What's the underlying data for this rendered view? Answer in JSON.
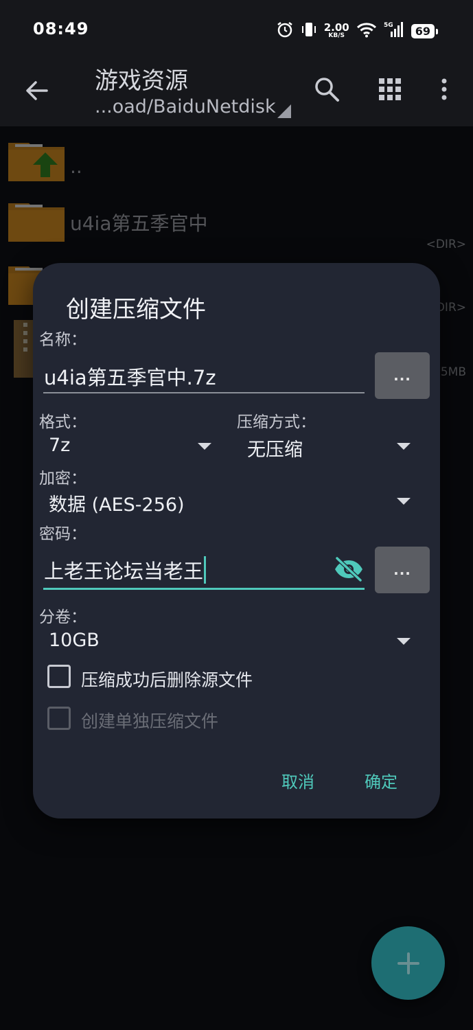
{
  "status_bar": {
    "time": "08:49",
    "net_speed_value": "2.00",
    "net_speed_unit": "KB/S",
    "signal_label": "5G",
    "battery": "69",
    "icons": [
      "alarm-icon",
      "vibrate-icon",
      "wifi-icon",
      "signal-icon",
      "battery-icon"
    ]
  },
  "app_bar": {
    "title": "游戏资源",
    "path": "...oad/BaiduNetdisk",
    "icons": [
      "back-arrow-icon",
      "search-icon",
      "grid-view-icon",
      "more-vert-icon"
    ]
  },
  "file_list": [
    {
      "name": "..",
      "meta": ""
    },
    {
      "name": "u4ia第五季官中",
      "meta": "<DIR>"
    },
    {
      "name": "",
      "meta": "<DIR>"
    },
    {
      "name": "",
      "meta": "5MB"
    }
  ],
  "dialog": {
    "title": "创建压缩文件",
    "name_label": "名称：",
    "name_value": "u4ia第五季官中.7z",
    "browse_label": "...",
    "format_label": "格式：",
    "format_value": "7z",
    "compression_label": "压缩方式：",
    "compression_value": "无压缩",
    "encryption_label": "加密：",
    "encryption_value": "数据 (AES-256)",
    "password_label": "密码：",
    "password_value": "上老王论坛当老王",
    "password_more_label": "...",
    "volume_label": "分卷：",
    "volume_value": "10GB",
    "delete_source_label": "压缩成功后删除源文件",
    "delete_source_checked": false,
    "separate_archive_label": "创建单独压缩文件",
    "separate_archive_checked": false,
    "separate_archive_enabled": false,
    "cancel_label": "取消",
    "ok_label": "确定"
  },
  "colors": {
    "accent": "#4fc9bb",
    "dialog_bg": "#222633",
    "fab": "#1e6e73",
    "folder": "#b97a1e"
  }
}
